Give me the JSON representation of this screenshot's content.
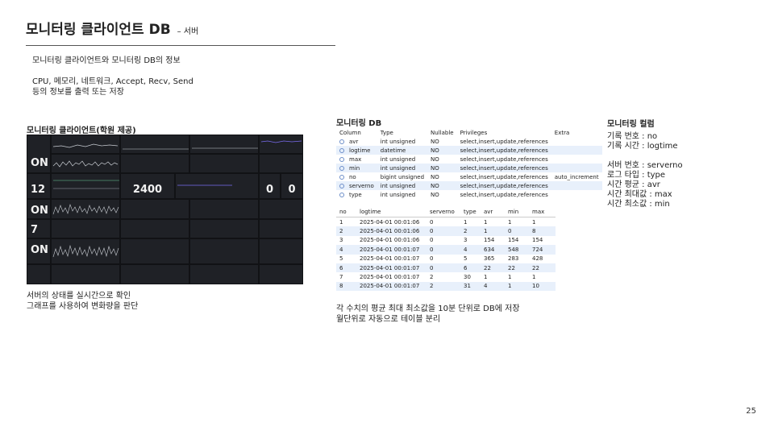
{
  "header": {
    "title": "모니터링 클라이언트 DB",
    "subtitle": "– 서버"
  },
  "intro": {
    "line1": "모니터링 클라이언트와 모니터링 DB의 정보",
    "line2": "CPU, 메모리, 네트워크, Accept, Recv, Send",
    "line3": "등의 정보를 출력 또는 저장"
  },
  "dashboard": {
    "title": "모니터링 클라이언트(학원 제공)",
    "values": {
      "status1": "ON",
      "count1": "12",
      "status2": "ON",
      "count2": "7",
      "status3": "ON",
      "total": "2400",
      "zero1": "0",
      "zero2": "0"
    },
    "caption1": "서버의 상태를 실시간으로 확인",
    "caption2": "그래프를 사용하여 변화량을 판단"
  },
  "db": {
    "title": "모니터링 DB",
    "schema_headers": [
      "Column",
      "Type",
      "Nullable",
      "Privileges",
      "Extra"
    ],
    "schema_rows": [
      [
        "avr",
        "int unsigned",
        "NO",
        "select,insert,update,references",
        ""
      ],
      [
        "logtime",
        "datetime",
        "NO",
        "select,insert,update,references",
        ""
      ],
      [
        "max",
        "int unsigned",
        "NO",
        "select,insert,update,references",
        ""
      ],
      [
        "min",
        "int unsigned",
        "NO",
        "select,insert,update,references",
        ""
      ],
      [
        "no",
        "bigint unsigned",
        "NO",
        "select,insert,update,references",
        "auto_increment"
      ],
      [
        "serverno",
        "int unsigned",
        "NO",
        "select,insert,update,references",
        ""
      ],
      [
        "type",
        "int unsigned",
        "NO",
        "select,insert,update,references",
        ""
      ]
    ],
    "data_headers": [
      "no",
      "logtime",
      "serverno",
      "type",
      "avr",
      "min",
      "max"
    ],
    "data_rows": [
      [
        "1",
        "2025-04-01 00:01:06",
        "0",
        "1",
        "1",
        "1",
        "1"
      ],
      [
        "2",
        "2025-04-01 00:01:06",
        "0",
        "2",
        "1",
        "0",
        "8"
      ],
      [
        "3",
        "2025-04-01 00:01:06",
        "0",
        "3",
        "154",
        "154",
        "154"
      ],
      [
        "4",
        "2025-04-01 00:01:07",
        "0",
        "4",
        "634",
        "548",
        "724"
      ],
      [
        "5",
        "2025-04-01 00:01:07",
        "0",
        "5",
        "365",
        "283",
        "428"
      ],
      [
        "6",
        "2025-04-01 00:01:07",
        "0",
        "6",
        "22",
        "22",
        "22"
      ],
      [
        "7",
        "2025-04-01 00:01:07",
        "2",
        "30",
        "1",
        "1",
        "1"
      ],
      [
        "8",
        "2025-04-01 00:01:07",
        "2",
        "31",
        "4",
        "1",
        "10"
      ]
    ],
    "caption1": "각 수치의 평균 최대 최소값을 10분 단위로 DB에 저장",
    "caption2": "월단위로 자동으로 테이블 분리"
  },
  "columns": {
    "title": "모니터링 컬럼",
    "lines": [
      "기록 번호 : no",
      "기록 시간 : logtime",
      "",
      "서버 번호 : serverno",
      "로그 타입 : type",
      "시간 평균 : avr",
      "시간 최대값 : max",
      "시간 최소값 : min"
    ]
  },
  "page_number": "25",
  "colors": {
    "dashboard_bg": "#111215",
    "panel_bg": "#1f2126",
    "graph_line": "#c8ccd2",
    "accent_line": "#7a6cf0",
    "row_alt": "#e8f0fb"
  }
}
